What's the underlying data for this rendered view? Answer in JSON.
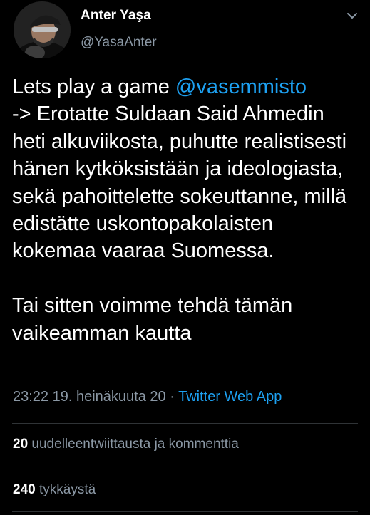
{
  "tweet": {
    "author": {
      "name": "Anter Yaşa",
      "handle": "@YasaAnter"
    },
    "text": {
      "intro": "Lets play a game ",
      "mention": "@vasemmisto",
      "body": "\n-> Erotatte Suldaan Said Ahmedin heti alkuviikosta, puhutte realistisesti hänen kytköksistään ja ideologiasta, sekä pahoittelette sokeuttanne, millä edistätte uskontopakolaisten kokemaa vaaraa Suomessa.\n\nTai sitten voimme tehdä tämän vaikeamman kautta"
    },
    "meta": {
      "timestamp": "23:22 19. heinäkuuta 20",
      "separator": "·",
      "source": "Twitter Web App"
    },
    "stats": {
      "retweets": {
        "count": "20",
        "label": "uudelleentwiittausta ja kommenttia"
      },
      "likes": {
        "count": "240",
        "label": "tykkäystä"
      }
    },
    "icons": {
      "more": "chevron-down-icon"
    },
    "colors": {
      "background": "#000000",
      "primary_text": "#ffffff",
      "secondary_text": "#8b98a5",
      "link": "#1da1f2",
      "divider": "#2f3336"
    }
  }
}
